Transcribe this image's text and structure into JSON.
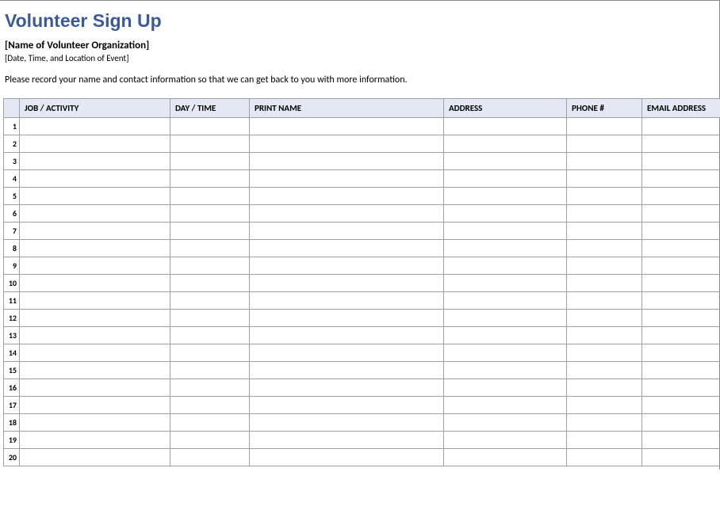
{
  "title": "Volunteer Sign Up",
  "org": "[Name of Volunteer Organization]",
  "event": "[Date, Time, and Location of Event]",
  "instructions": "Please record your name and contact information so that we can get back to you with more information.",
  "columns": {
    "job": "JOB / ACTIVITY",
    "day": "DAY / TIME",
    "name": "PRINT NAME",
    "address": "ADDRESS",
    "phone": "PHONE #",
    "email": "EMAIL ADDRESS"
  },
  "rows": [
    {
      "n": "1",
      "job": "",
      "day": "",
      "name": "",
      "address": "",
      "phone": "",
      "email": ""
    },
    {
      "n": "2",
      "job": "",
      "day": "",
      "name": "",
      "address": "",
      "phone": "",
      "email": ""
    },
    {
      "n": "3",
      "job": "",
      "day": "",
      "name": "",
      "address": "",
      "phone": "",
      "email": ""
    },
    {
      "n": "4",
      "job": "",
      "day": "",
      "name": "",
      "address": "",
      "phone": "",
      "email": ""
    },
    {
      "n": "5",
      "job": "",
      "day": "",
      "name": "",
      "address": "",
      "phone": "",
      "email": ""
    },
    {
      "n": "6",
      "job": "",
      "day": "",
      "name": "",
      "address": "",
      "phone": "",
      "email": ""
    },
    {
      "n": "7",
      "job": "",
      "day": "",
      "name": "",
      "address": "",
      "phone": "",
      "email": ""
    },
    {
      "n": "8",
      "job": "",
      "day": "",
      "name": "",
      "address": "",
      "phone": "",
      "email": ""
    },
    {
      "n": "9",
      "job": "",
      "day": "",
      "name": "",
      "address": "",
      "phone": "",
      "email": ""
    },
    {
      "n": "10",
      "job": "",
      "day": "",
      "name": "",
      "address": "",
      "phone": "",
      "email": ""
    },
    {
      "n": "11",
      "job": "",
      "day": "",
      "name": "",
      "address": "",
      "phone": "",
      "email": ""
    },
    {
      "n": "12",
      "job": "",
      "day": "",
      "name": "",
      "address": "",
      "phone": "",
      "email": ""
    },
    {
      "n": "13",
      "job": "",
      "day": "",
      "name": "",
      "address": "",
      "phone": "",
      "email": ""
    },
    {
      "n": "14",
      "job": "",
      "day": "",
      "name": "",
      "address": "",
      "phone": "",
      "email": ""
    },
    {
      "n": "15",
      "job": "",
      "day": "",
      "name": "",
      "address": "",
      "phone": "",
      "email": ""
    },
    {
      "n": "16",
      "job": "",
      "day": "",
      "name": "",
      "address": "",
      "phone": "",
      "email": ""
    },
    {
      "n": "17",
      "job": "",
      "day": "",
      "name": "",
      "address": "",
      "phone": "",
      "email": ""
    },
    {
      "n": "18",
      "job": "",
      "day": "",
      "name": "",
      "address": "",
      "phone": "",
      "email": ""
    },
    {
      "n": "19",
      "job": "",
      "day": "",
      "name": "",
      "address": "",
      "phone": "",
      "email": ""
    },
    {
      "n": "20",
      "job": "",
      "day": "",
      "name": "",
      "address": "",
      "phone": "",
      "email": ""
    }
  ]
}
